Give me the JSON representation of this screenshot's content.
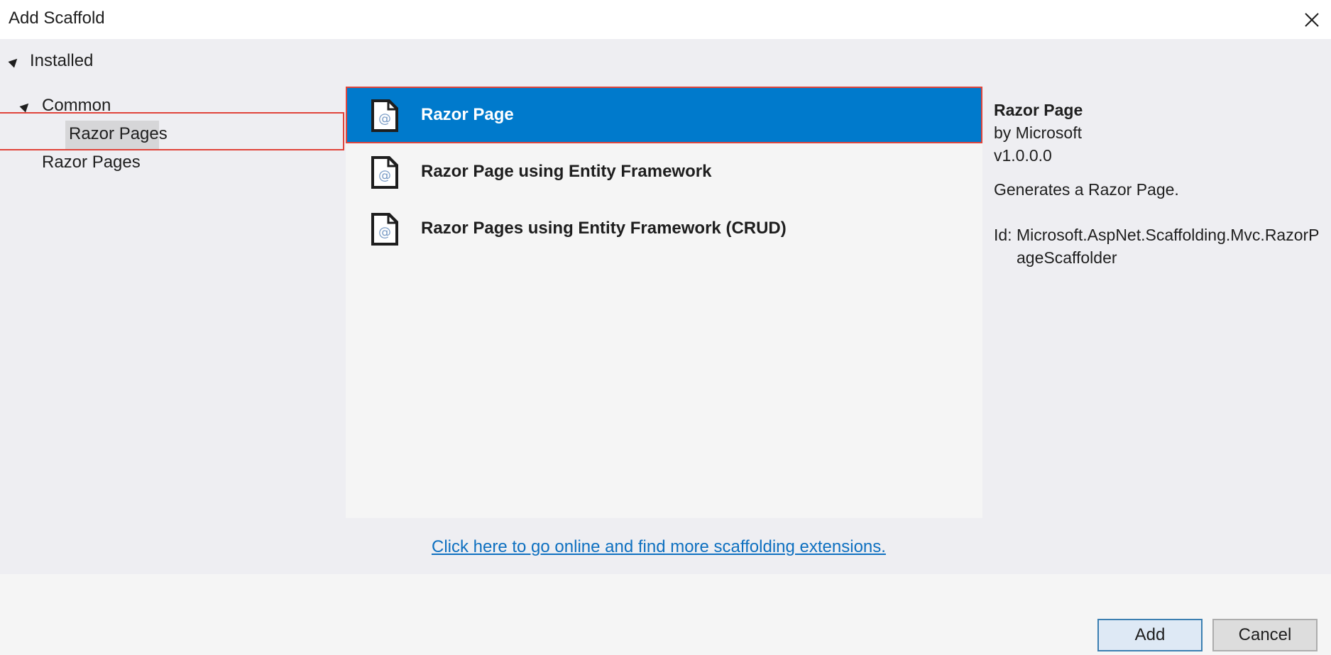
{
  "window": {
    "title": "Add Scaffold",
    "close_icon": "close-icon"
  },
  "tree": {
    "installed": "Installed",
    "common": "Common",
    "common_child": "Razor Pages",
    "sibling": "Razor Pages"
  },
  "items": [
    {
      "label": "Razor Page",
      "icon": "razor-file-icon"
    },
    {
      "label": "Razor Page using Entity Framework",
      "icon": "razor-file-icon"
    },
    {
      "label": "Razor Pages using Entity Framework (CRUD)",
      "icon": "razor-file-icon"
    }
  ],
  "details": {
    "name": "Razor Page",
    "author": "by Microsoft",
    "version": "v1.0.0.0",
    "description": "Generates a Razor Page.",
    "id_label": "Id:",
    "id_line1": "Microsoft.AspNet.Scaffolding.Mvc.RazorP",
    "id_line2": "ageScaffolder"
  },
  "link_text": "Click here to go online and find more scaffolding extensions.",
  "buttons": {
    "add": "Add",
    "cancel": "Cancel"
  },
  "colors": {
    "selected": "#007acc",
    "highlight": "#e0443b",
    "link": "#0e70c0"
  }
}
